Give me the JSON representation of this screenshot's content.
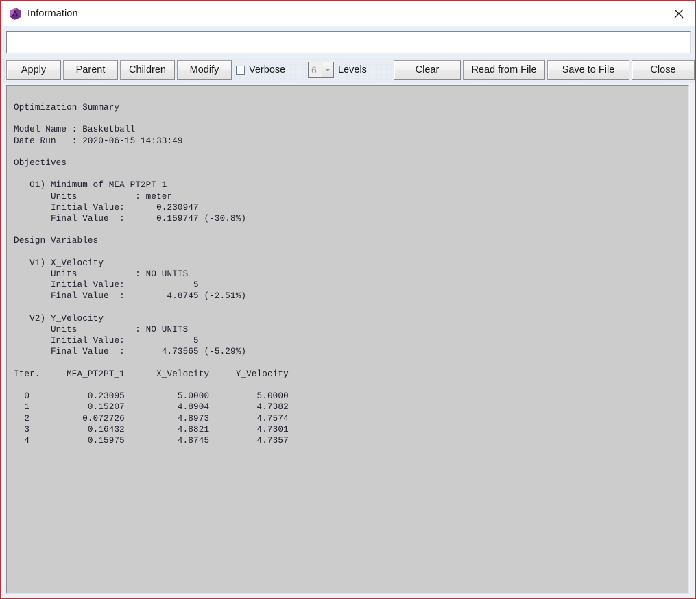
{
  "window": {
    "title": "Information",
    "icon": "app-diamond-icon",
    "close_icon": "close-icon",
    "border_color": "#a33b44"
  },
  "entry": {
    "value": "",
    "placeholder": ""
  },
  "toolbar": {
    "apply_label": "Apply",
    "parent_label": "Parent",
    "children_label": "Children",
    "modify_label": "Modify",
    "verbose_label": "Verbose",
    "verbose_checked": false,
    "levels_value": "6",
    "levels_label": "Levels",
    "clear_label": "Clear",
    "read_from_file_label": "Read from File",
    "save_to_file_label": "Save to File",
    "close_label": "Close"
  },
  "report": {
    "title": "Optimization Summary",
    "model_name_label": "Model Name",
    "model_name_value": "Basketball",
    "date_run_label": "Date Run",
    "date_run_value": "2020-06-15 14:33:49",
    "objectives_heading": "Objectives",
    "objectives": [
      {
        "id": "O1)",
        "name": "Minimum of MEA_PT2PT_1",
        "units": "meter",
        "initial_value": "0.230947",
        "final_value": "0.159747",
        "final_pct": "(-30.8%)"
      }
    ],
    "design_variables_heading": "Design Variables",
    "design_variables": [
      {
        "id": "V1)",
        "name": "X_Velocity",
        "units": "NO UNITS",
        "initial_value": "5",
        "final_value": "4.8745",
        "final_pct": "(-2.51%)"
      },
      {
        "id": "V2)",
        "name": "Y_Velocity",
        "units": "NO UNITS",
        "initial_value": "5",
        "final_value": "4.73565",
        "final_pct": "(-5.29%)"
      }
    ],
    "table": {
      "headers": [
        "Iter.",
        "MEA_PT2PT_1",
        "X_Velocity",
        "Y_Velocity"
      ],
      "rows": [
        [
          "0",
          "0.23095",
          "5.0000",
          "5.0000"
        ],
        [
          "1",
          "0.15207",
          "4.8904",
          "4.7382"
        ],
        [
          "2",
          "0.072726",
          "4.8973",
          "4.7574"
        ],
        [
          "3",
          "0.16432",
          "4.8821",
          "4.7301"
        ],
        [
          "4",
          "0.15975",
          "4.8745",
          "4.7357"
        ]
      ]
    },
    "body": "Optimization Summary\n\nModel Name : Basketball\nDate Run   : 2020-06-15 14:33:49\n\nObjectives\n\n   O1) Minimum of MEA_PT2PT_1\n       Units           : meter\n       Initial Value:      0.230947\n       Final Value  :      0.159747 (-30.8%)\n\nDesign Variables\n\n   V1) X_Velocity\n       Units           : NO UNITS\n       Initial Value:             5\n       Final Value  :        4.8745 (-2.51%)\n\n   V2) Y_Velocity\n       Units           : NO UNITS\n       Initial Value:             5\n       Final Value  :       4.73565 (-5.29%)\n\nIter.     MEA_PT2PT_1      X_Velocity     Y_Velocity\n\n  0           0.23095          5.0000         5.0000\n  1           0.15207          4.8904         4.7382\n  2          0.072726          4.8973         4.7574\n  3           0.16432          4.8821         4.7301\n  4           0.15975          4.8745         4.7357"
  }
}
